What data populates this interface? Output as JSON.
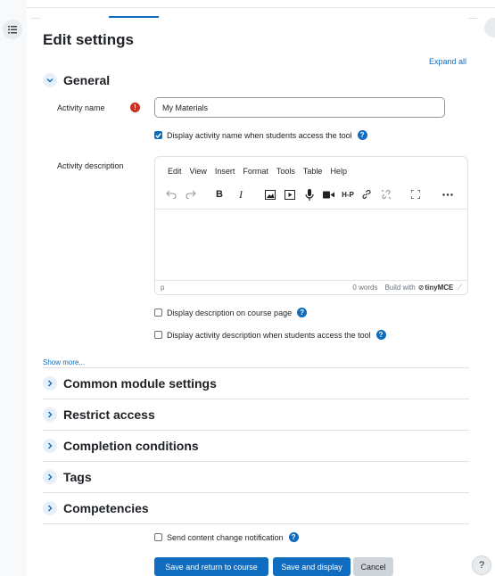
{
  "page": {
    "title": "Edit settings",
    "expand_all": "Expand all"
  },
  "sections": {
    "general": "General",
    "common_module": "Common module settings",
    "restrict_access": "Restrict access",
    "completion": "Completion conditions",
    "tags": "Tags",
    "competencies": "Competencies"
  },
  "general": {
    "activity_name_label": "Activity name",
    "activity_name_value": "My Materials",
    "display_name_label": "Display activity name when students access the tool",
    "display_name_checked": true,
    "activity_description_label": "Activity description",
    "display_description_label": "Display description on course page",
    "display_description_checked": false,
    "display_activity_desc_label": "Display activity description when students access the tool",
    "display_activity_desc_checked": false,
    "show_more": "Show more..."
  },
  "editor": {
    "menu": [
      "Edit",
      "View",
      "Insert",
      "Format",
      "Tools",
      "Table",
      "Help"
    ],
    "toolbar": {
      "bold": "B",
      "italic": "I",
      "h5p": "H-P"
    },
    "status_path": "p",
    "word_count": "0 words",
    "build_with": "Build with",
    "brand": "tinyMCE"
  },
  "footer": {
    "notify_label": "Send content change notification",
    "notify_checked": false,
    "save_return": "Save and return to course",
    "save_display": "Save and display",
    "cancel": "Cancel",
    "help": "?"
  },
  "colors": {
    "primary": "#0f6cbf",
    "required": "#ca3120"
  }
}
